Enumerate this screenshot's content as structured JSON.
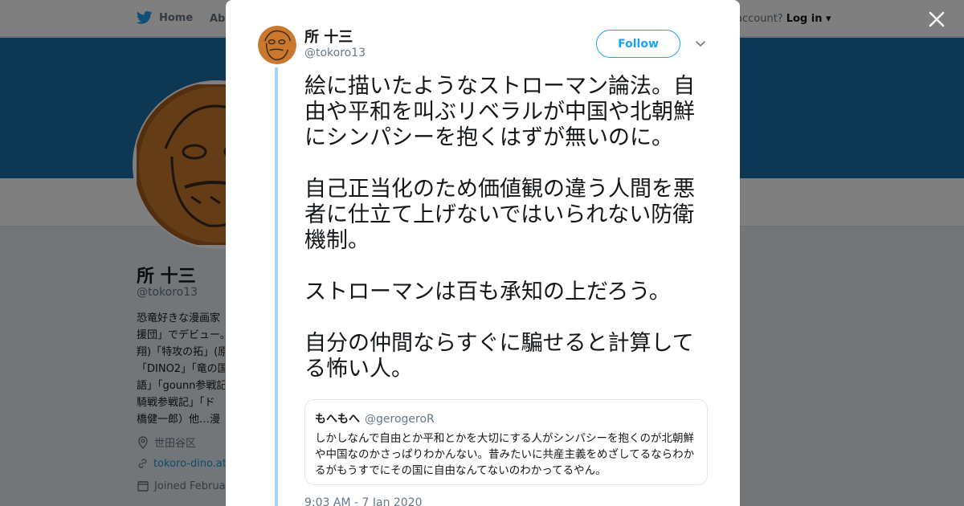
{
  "topnav": {
    "home_label": "Home",
    "about_label": "Abo",
    "account_prompt": "account?",
    "login_label": "Log in"
  },
  "profile": {
    "name": "所 十三",
    "handle": "@tokoro13",
    "bio_lines": [
      "恐竜好きな漫画家",
      "援団」でデビュー。",
      "翔)「特攻の拓」(原",
      "「DINO2」「竜の国の",
      "語」「gounn参戦記",
      "騎戦参戦記」「ド",
      "橋健一郎）他…漫"
    ],
    "location": "世田谷区",
    "website": "tokoro-dino.at",
    "joined": "Joined Februa"
  },
  "tweet": {
    "author_name": "所 十三",
    "author_handle": "@tokoro13",
    "follow_label": "Follow",
    "paragraphs": [
      "絵に描いたようなストローマン論法。自由や平和を叫ぶリベラルが中国や北朝鮮にシンパシーを抱くはずが無いのに。",
      "自己正当化のため価値観の違う人間を悪者に仕立て上げないではいられない防衛機制。",
      "ストローマンは百も承知の上だろう。",
      "自分の仲間ならすぐに騙せると計算してる怖い人。"
    ],
    "quote": {
      "name": "もへもへ",
      "handle": "@gerogeroR",
      "text": "しかしなんで自由とか平和とかを大切にする人がシンパシーを抱くのが北朝鮮や中国なのかさっぱりわかんない。昔みたいに共産主義をめざしてるならわかるがもうすでにその国に自由なんてないのわかってるやん。"
    },
    "timestamp": "9:03 AM - 7 Jan 2020"
  },
  "colors": {
    "accent": "#1da1f2",
    "banner": "#1b6fa5",
    "thread_line": "#a3d4f3"
  },
  "icons": [
    "twitter-bird-icon",
    "close-icon",
    "chevron-down-icon",
    "location-icon",
    "link-icon",
    "calendar-icon"
  ]
}
